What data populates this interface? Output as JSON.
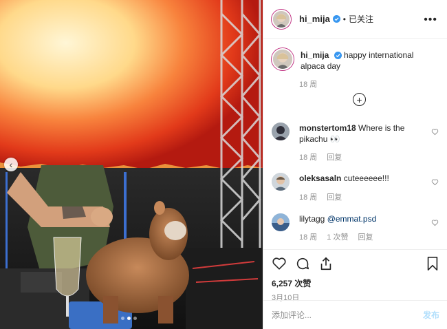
{
  "post": {
    "username": "hi_mija",
    "follow_state": "已关注",
    "separator": "•",
    "more_icon": "more-horizontal-icon"
  },
  "caption": {
    "username": "hi_mija",
    "text": "happy international alpaca day",
    "time": "18 周"
  },
  "comments": [
    {
      "username": "monstertom18",
      "text": "Where is the pikachu 👀",
      "time": "18 周",
      "reply": "回复"
    },
    {
      "username": "oleksasaln",
      "text": "cuteeeeee!!!",
      "time": "18 周",
      "reply": "回复"
    },
    {
      "username": "lilytagg",
      "mention": "@emmat.psd",
      "time": "18 周",
      "likes": "1 次赞",
      "reply": "回复"
    }
  ],
  "stats": {
    "likes": "6,257 次赞",
    "date": "3月10日"
  },
  "comment_box": {
    "placeholder": "添加评论...",
    "post_label": "发布"
  },
  "colors": {
    "verified": "#3897f0",
    "story_ring": "#c13584",
    "post_disabled": "#b2dffc",
    "secondary_text": "#8e8e8e"
  }
}
